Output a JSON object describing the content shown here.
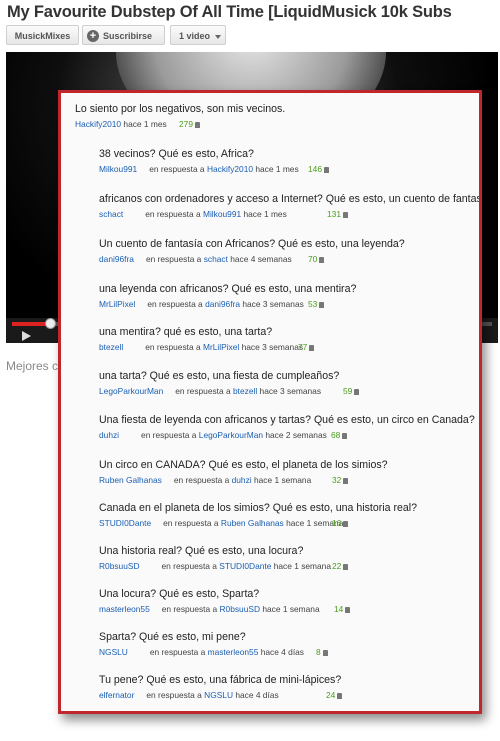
{
  "page_title": "My Favourite Dubstep Of All Time [LiquidMusick 10k Subs",
  "toolbar": {
    "channel_label": "MusickMixes",
    "subscribe_label": "Suscribirse",
    "videos_label": "1 video"
  },
  "player": {
    "progress_fraction": 0.08
  },
  "below_text": "Mejores co",
  "colors": {
    "panel_border": "#c0272d",
    "username": "#1a5fb4",
    "likes": "#4a9e1a"
  },
  "comments": [
    {
      "text": "Lo siento por los negativos, son mis vecinos.",
      "user": "Hackify2010",
      "reply_prefix": "",
      "reply_to": "",
      "time": "hace 1 mes",
      "likes": "279"
    },
    {
      "text": "38 vecinos? Qué es esto, Africa?",
      "user": "Milkou991",
      "reply_prefix": "en respuesta a",
      "reply_to": "Hackify2010",
      "time": "hace 1 mes",
      "likes": "146"
    },
    {
      "text": "africanos con ordenadores y acceso a Internet? Qué es esto, un cuento de fantasía?",
      "user": "schact",
      "reply_prefix": "en respuesta a",
      "reply_to": "Milkou991",
      "time": "hace 1 mes",
      "likes": "131"
    },
    {
      "text": "Un cuento de fantasía con Africanos? Qué es esto, una leyenda?",
      "user": "dani96fra",
      "reply_prefix": "en respuesta a",
      "reply_to": "schact",
      "time": "hace 4 semanas",
      "likes": "70"
    },
    {
      "text": "una leyenda con africanos? Qué es esto, una mentira?",
      "user": "MrLilPixel",
      "reply_prefix": "en respuesta a",
      "reply_to": "dani96fra",
      "time": "hace 3 semanas",
      "likes": "53"
    },
    {
      "text": "una mentira? qué es esto, una tarta?",
      "user": "btezell",
      "reply_prefix": "en respuesta a",
      "reply_to": "MrLilPixel",
      "time": "hace 3 semanas",
      "likes": "77"
    },
    {
      "text": "una tarta? Qué es esto, una fiesta de cumpleaños?",
      "user": "LegoParkourMan",
      "reply_prefix": "en respuesta a",
      "reply_to": "btezell",
      "time": "hace 3 semanas",
      "likes": "59"
    },
    {
      "text": "Una fiesta de leyenda con africanos y tartas? Qué es esto, un circo en Canada?",
      "user": "duhzi",
      "reply_prefix": "en respuesta a",
      "reply_to": "LegoParkourMan",
      "time": "hace 2 semanas",
      "likes": "68"
    },
    {
      "text": "Un circo en CANADA? Qué es esto, el planeta de los simios?",
      "user": "Ruben Galhanas",
      "reply_prefix": "en respuesta a",
      "reply_to": "duhzi",
      "time": "hace 1 semana",
      "likes": "32"
    },
    {
      "text": "Canada en el planeta de los simios? Qué es esto, una historia real?",
      "user": "STUDI0Dante",
      "reply_prefix": "en respuesta a",
      "reply_to": "Ruben Galhanas",
      "time": "hace 1 semana",
      "likes": "16"
    },
    {
      "text": "Una historia real? Qué es esto, una locura?",
      "user": "R0bsuuSD",
      "reply_prefix": "en respuesta a",
      "reply_to": "STUDI0Dante",
      "time": "hace 1 semana",
      "likes": "22"
    },
    {
      "text": "Una locura? Qué es esto, Sparta?",
      "user": "masterleon55",
      "reply_prefix": "en respuesta a",
      "reply_to": "R0bsuuSD",
      "time": "hace 1 semana",
      "likes": "14"
    },
    {
      "text": "Sparta? Qué es esto, mi pene?",
      "user": "NGSLU",
      "reply_prefix": "en respuesta a",
      "reply_to": "masterleon55",
      "time": "hace 4 días",
      "likes": "8"
    },
    {
      "text": "Tu pene? Qué es esto, una fábrica de mini-lápices?",
      "user": "elfernator",
      "reply_prefix": "en respuesta a",
      "reply_to": "NGSLU",
      "time": "hace 4 días",
      "likes": "24"
    }
  ]
}
